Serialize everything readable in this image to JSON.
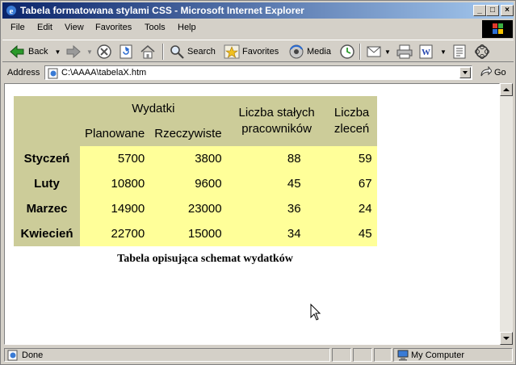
{
  "window": {
    "title": "Tabela formatowana stylami CSS - Microsoft Internet Explorer",
    "controls": [
      "minimize",
      "maximize",
      "close"
    ]
  },
  "menu": [
    "File",
    "Edit",
    "View",
    "Favorites",
    "Tools",
    "Help"
  ],
  "toolbar": {
    "back_label": "Back",
    "search_label": "Search",
    "favorites_label": "Favorites",
    "media_label": "Media",
    "icons": [
      "back-arrow-icon",
      "forward-arrow-icon",
      "stop-icon",
      "refresh-icon",
      "home-icon",
      "search-icon",
      "favorites-star-icon",
      "media-icon",
      "history-icon",
      "mail-icon",
      "print-icon",
      "edit-icon",
      "discuss-icon",
      "messenger-icon"
    ]
  },
  "address": {
    "label": "Address",
    "url": "C:\\AAAA\\tabelaX.htm",
    "go_label": "Go"
  },
  "table": {
    "group_header": "Wydatki",
    "sub_headers": [
      "Planowane",
      "Rzeczywiste"
    ],
    "col3_header": "Liczba stałych pracowników",
    "col4_header": "Liczba zleceń",
    "rows": [
      {
        "month": "Styczeń",
        "planned": "5700",
        "actual": "3800",
        "staff": "88",
        "orders": "59"
      },
      {
        "month": "Luty",
        "planned": "10800",
        "actual": "9600",
        "staff": "45",
        "orders": "67"
      },
      {
        "month": "Marzec",
        "planned": "14900",
        "actual": "23000",
        "staff": "36",
        "orders": "24"
      },
      {
        "month": "Kwiecień",
        "planned": "22700",
        "actual": "15000",
        "staff": "34",
        "orders": "45"
      }
    ],
    "caption": "Tabela opisująca schemat wydatków",
    "colors": {
      "header_bg": "#cccc99",
      "cell_bg": "#ffff99"
    }
  },
  "status": {
    "text": "Done",
    "zone": "My Computer"
  }
}
